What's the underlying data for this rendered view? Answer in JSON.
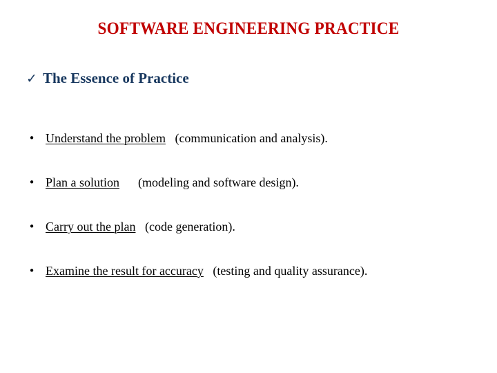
{
  "slide": {
    "title": "SOFTWARE ENGINEERING PRACTICE",
    "title_color": "#C00000",
    "background_color": "#FFFFFF",
    "body_text_color": "#000000"
  },
  "section": {
    "bullet_glyph": "✓",
    "heading": "The Essence of Practice",
    "heading_color": "#17375E"
  },
  "bullets": [
    {
      "glyph": "•",
      "term": "Understand the problem",
      "gap": "   ",
      "detail": "(communication and analysis)."
    },
    {
      "glyph": "•",
      "term": "Plan a solution",
      "gap": "      ",
      "detail": "(modeling and software design)."
    },
    {
      "glyph": "•",
      "term": "Carry out the plan",
      "gap": "   ",
      "detail": "(code generation)."
    },
    {
      "glyph": "•",
      "term": "Examine the result for accuracy",
      "gap": "   ",
      "detail": "(testing and quality assurance)."
    }
  ]
}
